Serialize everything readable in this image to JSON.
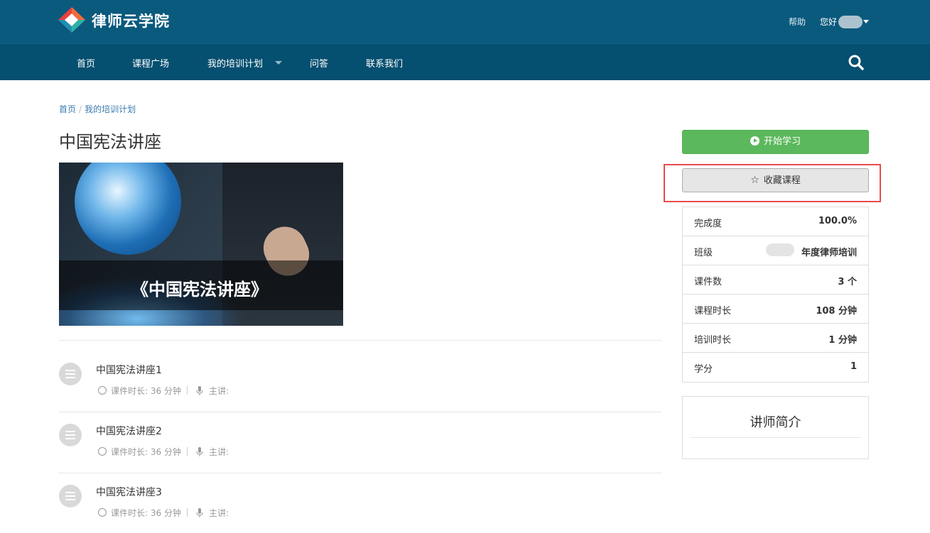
{
  "header": {
    "brand": "律师云学院",
    "help": "帮助",
    "greeting": "您好"
  },
  "nav": {
    "items": [
      "首页",
      "课程广场",
      "我的培训计划",
      "问答",
      "联系我们"
    ]
  },
  "breadcrumb": {
    "home": "首页",
    "current": "我的培训计划",
    "separator": "/"
  },
  "course": {
    "title": "中国宪法讲座",
    "banner_caption": "《中国宪法讲座》"
  },
  "lessons": [
    {
      "title": "中国宪法讲座1",
      "duration": "课件时长: 36 分钟",
      "lecturer": "主讲:"
    },
    {
      "title": "中国宪法讲座2",
      "duration": "课件时长: 36 分钟",
      "lecturer": "主讲:"
    },
    {
      "title": "中国宪法讲座3",
      "duration": "课件时长: 36 分钟",
      "lecturer": "主讲:"
    }
  ],
  "sidebar": {
    "start_button": "开始学习",
    "favorite_button": "收藏课程",
    "info": [
      {
        "label": "完成度",
        "value": "100.0%"
      },
      {
        "label": "班级",
        "value": "年度律师培训"
      },
      {
        "label": "课件数",
        "value": "3 个"
      },
      {
        "label": "课程时长",
        "value": "108 分钟"
      },
      {
        "label": "培训时长",
        "value": "1 分钟"
      },
      {
        "label": "学分",
        "value": "1"
      }
    ],
    "teacher_title": "讲师简介"
  },
  "colors": {
    "header_bg": "#0a5a7e",
    "nav_bg": "#054f70",
    "start_button": "#5cb85c",
    "highlight": "#e74c4c"
  }
}
